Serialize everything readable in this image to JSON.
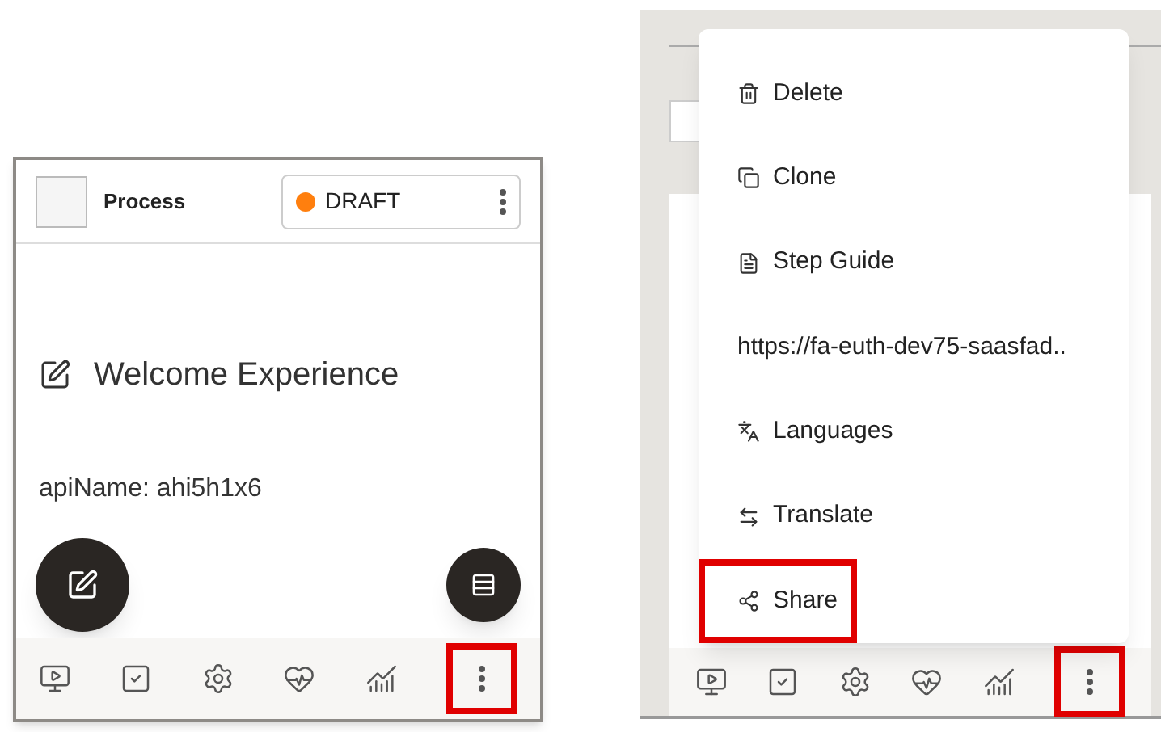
{
  "left_card": {
    "checked": false,
    "title": "Process",
    "status": {
      "label": "DRAFT"
    },
    "name": "Welcome Experience",
    "api_name": "apiName: ahi5h1x6",
    "more_highlighted": true
  },
  "right_panel": {
    "more_highlighted": true,
    "menu": [
      {
        "label": "Delete",
        "kind": "trash",
        "highlighted": false
      },
      {
        "label": "Clone",
        "kind": "copy",
        "highlighted": false
      },
      {
        "label": "Step Guide",
        "kind": "document",
        "highlighted": false
      },
      {
        "label": "https://fa-euth-dev75-saasfad..",
        "kind": "none",
        "highlighted": false
      },
      {
        "label": "Languages",
        "kind": "languages",
        "highlighted": false
      },
      {
        "label": "Translate",
        "kind": "translate",
        "highlighted": false
      },
      {
        "label": "Share",
        "kind": "share",
        "highlighted": true
      }
    ]
  }
}
